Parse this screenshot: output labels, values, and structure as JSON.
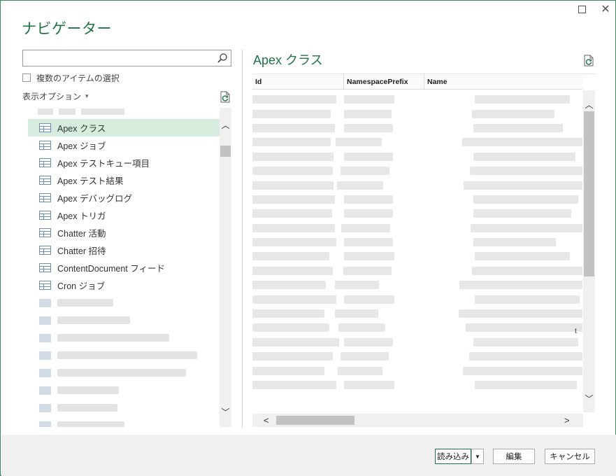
{
  "window": {
    "title": "ナビゲーター",
    "maximize_glyph": "",
    "close_glyph": "✕"
  },
  "left": {
    "search": {
      "value": "",
      "placeholder": ""
    },
    "multi_select_label": "複数のアイテムの選択",
    "display_options_label": "表示オプション",
    "display_options_caret": "▾",
    "tree_items": [
      {
        "label": "Apex クラス",
        "selected": true
      },
      {
        "label": "Apex ジョブ"
      },
      {
        "label": "Apex テストキュー項目"
      },
      {
        "label": "Apex テスト結果"
      },
      {
        "label": "Apex デバッグログ"
      },
      {
        "label": "Apex トリガ"
      },
      {
        "label": "Chatter 活動"
      },
      {
        "label": "Chatter 招待"
      },
      {
        "label": "ContentDocument フィード"
      },
      {
        "label": "Cron ジョブ"
      }
    ],
    "scroll_up": "︿",
    "scroll_down": "﹀"
  },
  "preview": {
    "title": "Apex クラス",
    "columns": [
      "Id",
      "NamespacePrefix",
      "Name"
    ],
    "truncated_char": "t",
    "h_left": "<",
    "h_right": ">",
    "v_up": "︿",
    "v_down": "﹀"
  },
  "footer": {
    "load_label": "読み込み",
    "load_dropdown": "▼",
    "edit_label": "編集",
    "cancel_label": "キャンセル"
  },
  "colors": {
    "accent": "#217346",
    "selected_bg": "#d6ecdd"
  }
}
